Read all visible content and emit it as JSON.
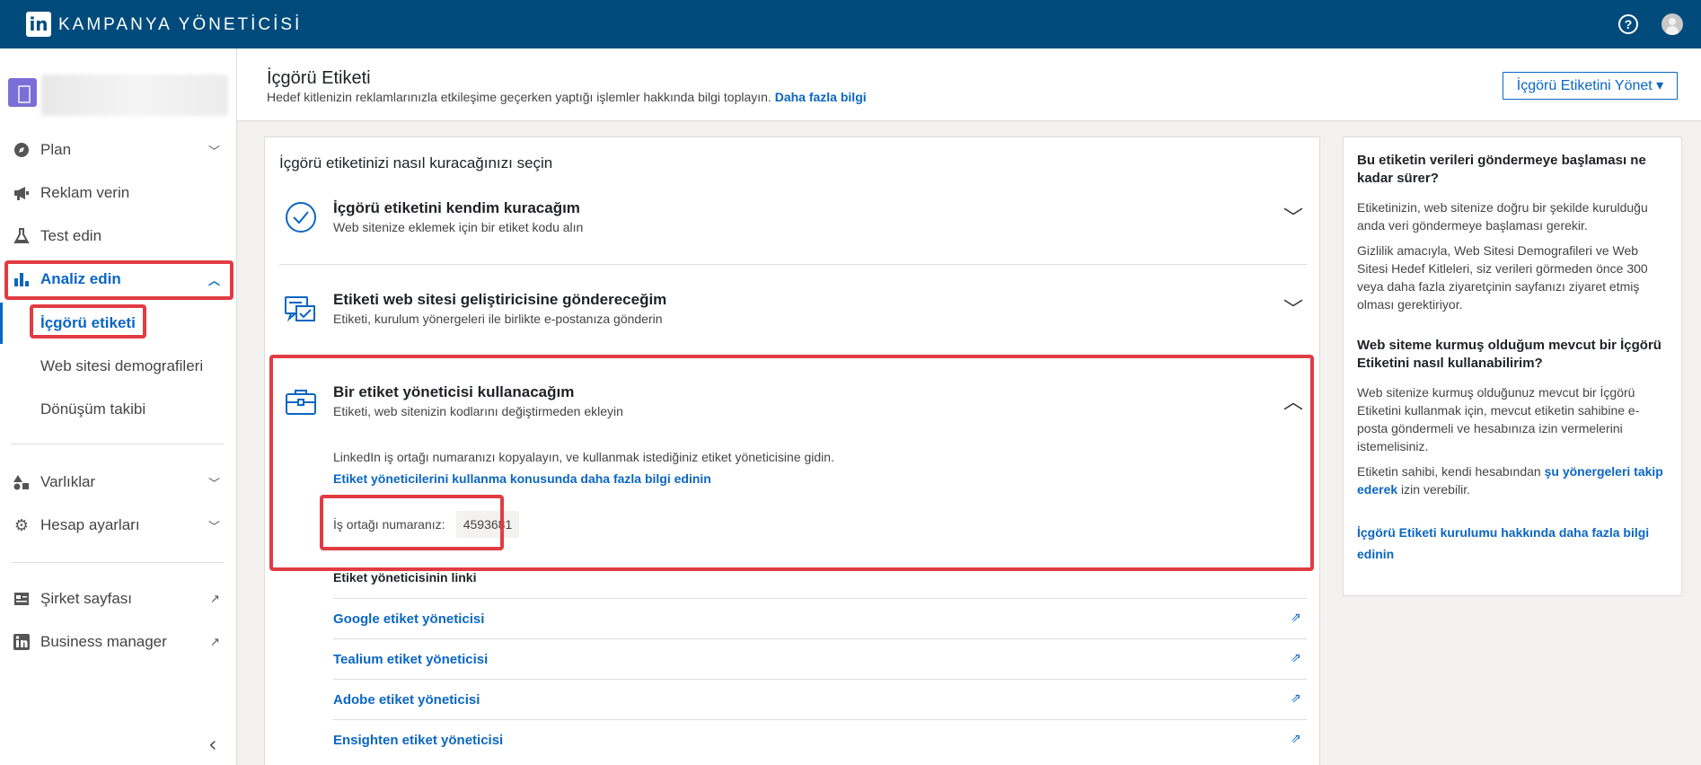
{
  "app": {
    "logo_text": "in",
    "title": "KAMPANYA YÖNETİCİSİ"
  },
  "header": {
    "title": "İçgörü Etiketi",
    "subtitle": "Hedef kitlenizin reklamlarınızla etkileşime geçerken yaptığı işlemler hakkında bilgi toplayın.",
    "learn_more": "Daha fazla bilgi",
    "manage_button": "İçgörü Etiketini Yönet ▾"
  },
  "sidebar": {
    "items": [
      {
        "label": "Plan",
        "icon": "compass-icon"
      },
      {
        "label": "Reklam verin",
        "icon": "megaphone-icon"
      },
      {
        "label": "Test edin",
        "icon": "flask-icon"
      },
      {
        "label": "Analiz edin",
        "icon": "bar-chart-icon"
      },
      {
        "label": "İçgörü etiketi"
      },
      {
        "label": "Web sitesi demografileri"
      },
      {
        "label": "Dönüşüm takibi"
      },
      {
        "label": "Varlıklar",
        "icon": "shapes-icon"
      },
      {
        "label": "Hesap ayarları",
        "icon": "gear-icon"
      },
      {
        "label": "Şirket sayfası",
        "icon": "company-page-icon"
      },
      {
        "label": "Business manager",
        "icon": "linkedin-icon"
      }
    ]
  },
  "main": {
    "heading": "İçgörü etiketinizi nasıl kuracağınızı seçin",
    "options": [
      {
        "title": "İçgörü etiketini kendim kuracağım",
        "desc": "Web sitenize eklemek için bir etiket kodu alın"
      },
      {
        "title": "Etiketi web sitesi geliştiricisine göndereceğim",
        "desc": "Etiketi, kurulum yönergeleri ile birlikte e-postanıza gönderin"
      },
      {
        "title": "Bir etiket yöneticisi kullanacağım",
        "desc": "Etiketi, web sitenizin kodlarını değiştirmeden ekleyin"
      }
    ],
    "instruction": "LinkedIn iş ortağı numaranızı kopyalayın, ve kullanmak istediğiniz etiket yöneticisine gidin.",
    "tag_manager_help": "Etiket yöneticilerini kullanma konusunda daha fazla bilgi edinin",
    "partner_label": "İş ortağı numaranız:",
    "partner_id": "4593681",
    "links_heading": "Etiket yöneticisinin linki",
    "tag_managers": [
      "Google etiket yöneticisi",
      "Tealium etiket yöneticisi",
      "Adobe etiket yöneticisi",
      "Ensighten etiket yöneticisi"
    ]
  },
  "info": {
    "q1": "Bu etiketin verileri göndermeye başlaması ne kadar sürer?",
    "a1_p1": "Etiketinizin, web sitenize doğru bir şekilde kurulduğu anda veri göndermeye başlaması gerekir.",
    "a1_p2": "Gizlilik amacıyla, Web Sitesi Demografileri ve Web Sitesi Hedef Kitleleri, siz verileri görmeden önce 300 veya daha fazla ziyaretçinin sayfanızı ziyaret etmiş olması gerektiriyor.",
    "q2": "Web siteme kurmuş olduğum mevcut bir İçgörü Etiketini nasıl kullanabilirim?",
    "a2_p1": "Web sitenize kurmuş olduğunuz mevcut bir İçgörü Etiketini kullanmak için, mevcut etiketin sahibine e-posta göndermeli ve hesabınıza izin vermelerini istemelisiniz.",
    "a2_p2_before": "Etiketin sahibi, kendi hesabından",
    "a2_p2_link": "şu yönergeleri takip ederek",
    "a2_p2_after": "izin verebilir.",
    "learn_link": "İçgörü Etiketi kurulumu hakkında daha fazla bilgi edinin"
  }
}
